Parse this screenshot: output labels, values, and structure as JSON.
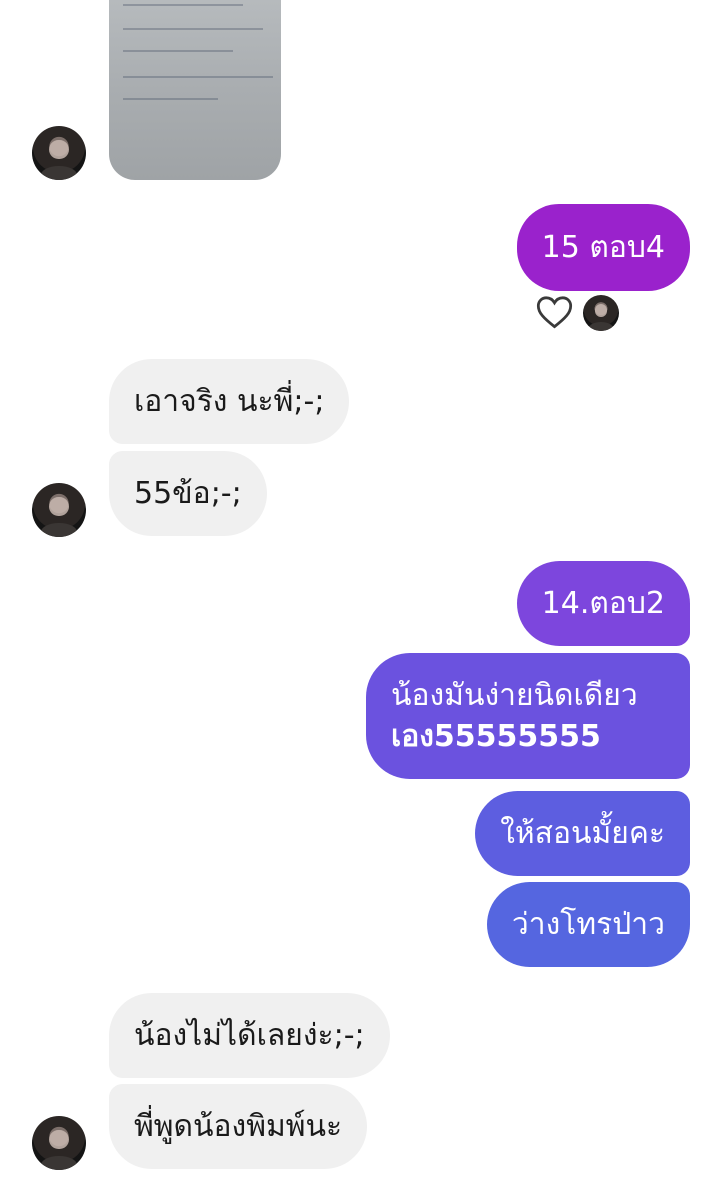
{
  "thread": {
    "shared_photo": {
      "description": "photo of a worksheet"
    },
    "messages": [
      {
        "side": "sent",
        "text": "15 ตอบ4",
        "color": "#9a22cc"
      },
      {
        "side": "received",
        "text": "เอาจริง นะพี่;-;"
      },
      {
        "side": "received",
        "text": "55ข้อ;-;"
      },
      {
        "side": "sent",
        "text": "14.ตอบ2",
        "color": "#7d46dd"
      },
      {
        "side": "sent",
        "lines": [
          "น้องมันง่ายนิดเดียว",
          "เอง55555555"
        ],
        "color": "#6b52df"
      },
      {
        "side": "sent",
        "text": "ให้สอนมั้ยคะ",
        "color": "#5d5ee0"
      },
      {
        "side": "sent",
        "text": "ว่างโทรป่าว",
        "color": "#5566e0"
      },
      {
        "side": "received",
        "text": "น้องไม่ได้เลยง่ะ;-;"
      },
      {
        "side": "received",
        "text": "พี่พูดน้องพิมพ์นะ"
      }
    ]
  },
  "reactions": {
    "heart_icon": "heart-outline-icon"
  },
  "colors": {
    "received_bubble": "#f0f0f0",
    "sent_purple": "#9a22cc",
    "sent_blue": "#5566e0"
  }
}
